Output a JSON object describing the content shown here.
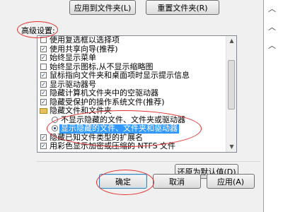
{
  "top_buttons": {
    "apply_to_folders": "应用到文件夹(L)",
    "reset_folders": "重置文件夹(R)"
  },
  "advanced": {
    "label": "高级设置:",
    "items": [
      {
        "type": "checkbox",
        "checked": false,
        "label": "使用复选框以选择项"
      },
      {
        "type": "checkbox",
        "checked": true,
        "label": "使用共享向导(推荐)"
      },
      {
        "type": "checkbox",
        "checked": true,
        "label": "始终显示菜单"
      },
      {
        "type": "checkbox",
        "checked": false,
        "label": "始终显示图标,从不显示缩略图"
      },
      {
        "type": "checkbox",
        "checked": true,
        "label": "鼠标指向文件夹和桌面项时显示提示信息"
      },
      {
        "type": "checkbox",
        "checked": true,
        "label": "显示驱动器号"
      },
      {
        "type": "checkbox",
        "checked": true,
        "label": "隐藏计算机文件夹中的空驱动器"
      },
      {
        "type": "checkbox",
        "checked": true,
        "label": "隐藏受保护的操作系统文件(推荐)"
      },
      {
        "type": "folder",
        "label": "隐藏文件和文件夹"
      },
      {
        "type": "radio",
        "checked": false,
        "label": "不显示隐藏的文件、文件夹或驱动器"
      },
      {
        "type": "radio",
        "checked": true,
        "selected": true,
        "label": "显示隐藏的文件、文件夹和驱动器"
      },
      {
        "type": "checkbox",
        "checked": true,
        "label": "隐藏已知文件类型的扩展名"
      },
      {
        "type": "checkbox",
        "checked": true,
        "label": "用彩色显示加密或压缩的 NTFS 文件"
      }
    ]
  },
  "restore_defaults": "还原为默认值(D)",
  "footer": {
    "ok": "确定",
    "cancel": "取消",
    "apply": "应用(A)"
  },
  "colors": {
    "highlight_circle": "#e53030",
    "selection": "#3399ff"
  }
}
